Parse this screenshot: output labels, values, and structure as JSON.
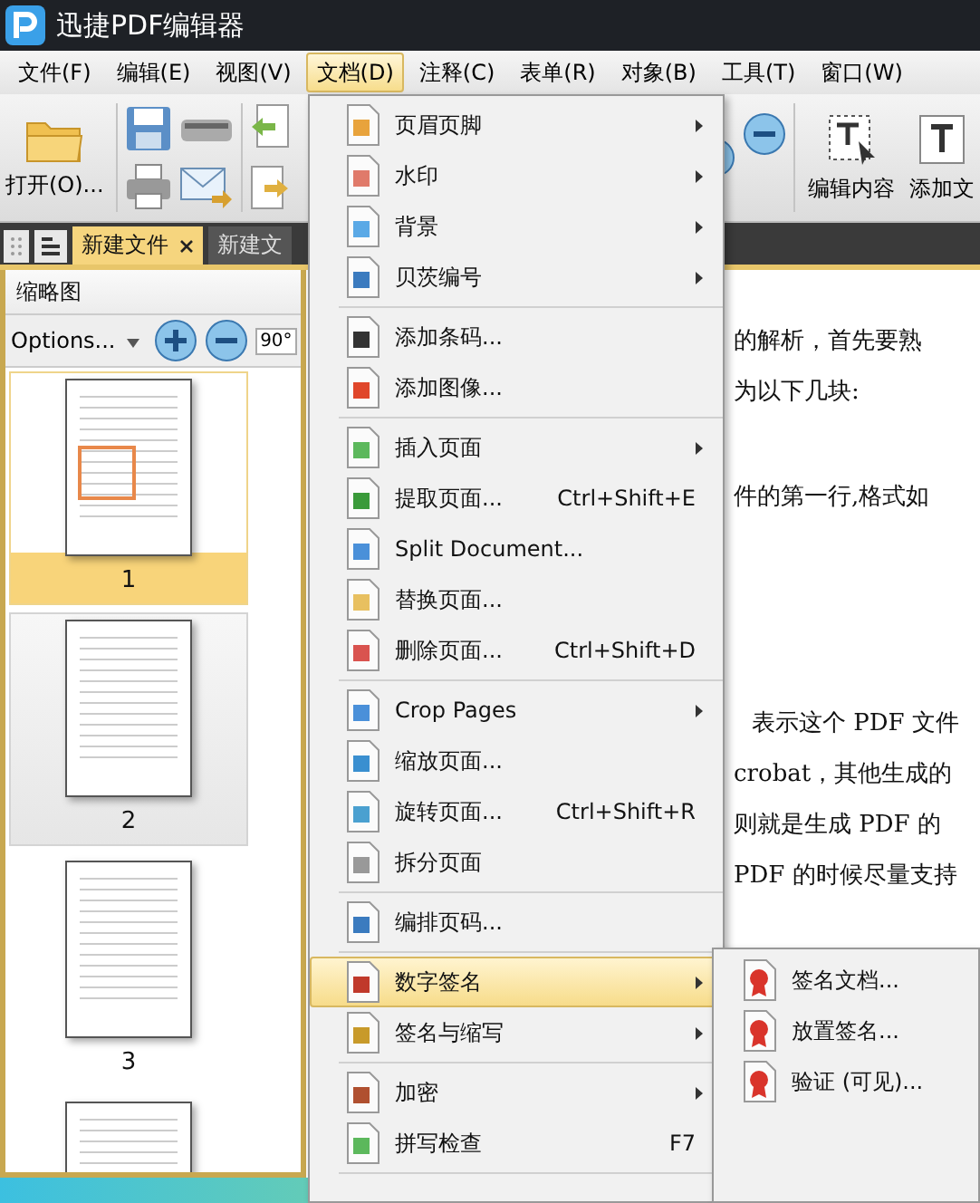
{
  "window": {
    "title": "迅捷PDF编辑器"
  },
  "menubar": [
    {
      "label": "文件(F)",
      "selected": false
    },
    {
      "label": "编辑(E)",
      "selected": false
    },
    {
      "label": "视图(V)",
      "selected": false
    },
    {
      "label": "文档(D)",
      "selected": true
    },
    {
      "label": "注释(C)",
      "selected": false
    },
    {
      "label": "表单(R)",
      "selected": false
    },
    {
      "label": "对象(B)",
      "selected": false
    },
    {
      "label": "工具(T)",
      "selected": false
    },
    {
      "label": "窗口(W)",
      "selected": false
    }
  ],
  "toolbar": {
    "open_label": "打开(O)...",
    "edit_content_label": "编辑内容",
    "add_text_label": "添加文"
  },
  "tabs": [
    {
      "label": "新建文件",
      "selected": true
    },
    {
      "label": "新建文",
      "selected": false
    }
  ],
  "thumbnails": {
    "title": "缩略图",
    "options_label": "Options...",
    "rotate_label": "90°",
    "pages": [
      {
        "label": "1",
        "selected": true,
        "hovered": false
      },
      {
        "label": "2",
        "selected": false,
        "hovered": true
      },
      {
        "label": "3",
        "selected": false,
        "hovered": false
      },
      {
        "selected": false,
        "hovered": false
      }
    ]
  },
  "document": {
    "lines": [
      "的解析，首先要熟",
      "为以下几块:",
      "件的第一行,格式如",
      "表示这个 PDF 文件",
      "crobat，其他生成的",
      "则就是生成 PDF 的",
      "PDF 的时候尽量支持"
    ]
  },
  "document_menu": [
    {
      "kind": "item",
      "label": "页眉页脚",
      "submenu": true,
      "selected": false
    },
    {
      "kind": "item",
      "label": "水印",
      "submenu": true,
      "selected": false
    },
    {
      "kind": "item",
      "label": "背景",
      "submenu": true,
      "selected": false
    },
    {
      "kind": "item",
      "label": "贝茨编号",
      "submenu": true,
      "selected": false
    },
    {
      "kind": "separator"
    },
    {
      "kind": "item",
      "label": "添加条码...",
      "submenu": false,
      "selected": false
    },
    {
      "kind": "item",
      "label": "添加图像...",
      "submenu": false,
      "selected": false
    },
    {
      "kind": "separator"
    },
    {
      "kind": "item",
      "label": "插入页面",
      "submenu": true,
      "selected": false
    },
    {
      "kind": "item",
      "label": "提取页面...",
      "shortcut": "Ctrl+Shift+E",
      "submenu": false,
      "selected": false
    },
    {
      "kind": "item",
      "label": "Split Document...",
      "submenu": false,
      "selected": false
    },
    {
      "kind": "item",
      "label": "替换页面...",
      "submenu": false,
      "selected": false
    },
    {
      "kind": "item",
      "label": "删除页面...",
      "shortcut": "Ctrl+Shift+D",
      "submenu": false,
      "selected": false
    },
    {
      "kind": "separator"
    },
    {
      "kind": "item",
      "label": "Crop Pages",
      "submenu": true,
      "selected": false
    },
    {
      "kind": "item",
      "label": "缩放页面...",
      "submenu": false,
      "selected": false
    },
    {
      "kind": "item",
      "label": "旋转页面...",
      "shortcut": "Ctrl+Shift+R",
      "submenu": false,
      "selected": false
    },
    {
      "kind": "item",
      "label": "拆分页面",
      "submenu": false,
      "selected": false
    },
    {
      "kind": "separator"
    },
    {
      "kind": "item",
      "label": "编排页码...",
      "submenu": false,
      "selected": false
    },
    {
      "kind": "separator"
    },
    {
      "kind": "item",
      "label": "数字签名",
      "submenu": true,
      "selected": true
    },
    {
      "kind": "item",
      "label": "签名与缩写",
      "submenu": true,
      "selected": false
    },
    {
      "kind": "separator"
    },
    {
      "kind": "item",
      "label": "加密",
      "submenu": true,
      "selected": false
    },
    {
      "kind": "item",
      "label": "拼写检查",
      "shortcut": "F7",
      "submenu": false,
      "selected": false
    },
    {
      "kind": "separator"
    }
  ],
  "signature_submenu": [
    {
      "label": "签名文档..."
    },
    {
      "label": "放置签名..."
    },
    {
      "label": "验证 (可见)..."
    }
  ]
}
